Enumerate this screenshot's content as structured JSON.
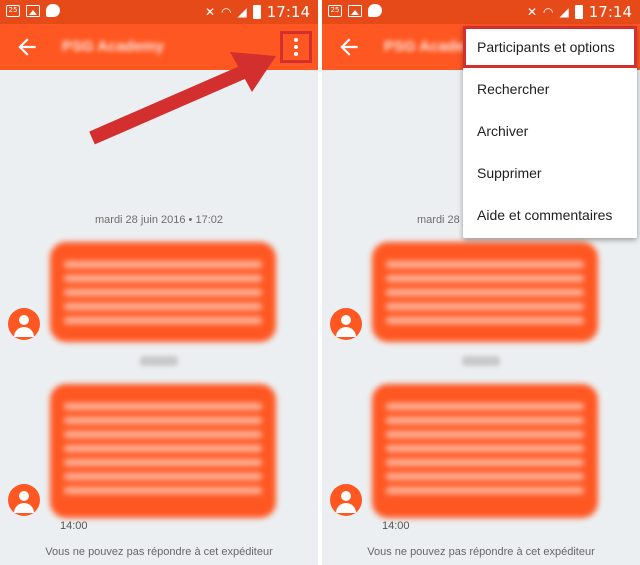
{
  "status_bar": {
    "time": "17:14",
    "left_badge": "25"
  },
  "conversation": {
    "title": "PSG Academy",
    "date_label": "mardi 28 juin 2016 • 17:02",
    "message_time": "14:00",
    "footer_note": "Vous ne pouvez pas répondre à cet expéditeur"
  },
  "menu": {
    "items": [
      {
        "label": "Participants et options"
      },
      {
        "label": "Rechercher"
      },
      {
        "label": "Archiver"
      },
      {
        "label": "Supprimer"
      },
      {
        "label": "Aide et commentaires"
      }
    ]
  },
  "colors": {
    "app_bar": "#ff5722",
    "status_bar": "#e64a19",
    "bubble": "#ff5722",
    "annotation": "#d32f2f",
    "background": "#eceff1"
  },
  "icons": {
    "back": "arrow-left-icon",
    "overflow": "more-vert-icon",
    "avatar": "person-icon"
  }
}
